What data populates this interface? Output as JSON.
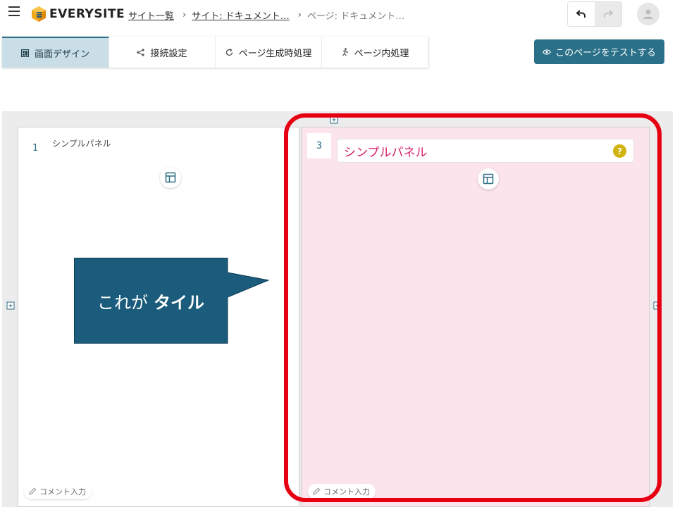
{
  "header": {
    "logo_text": "EVERYSITE",
    "breadcrumb": [
      {
        "label": "サイト一覧",
        "link": true
      },
      {
        "label": "サイト: ドキュメント…",
        "link": true
      },
      {
        "label": "ページ: ドキュメント…",
        "link": false
      }
    ]
  },
  "tabs": [
    {
      "label": "画面デザイン",
      "icon": "design-icon",
      "active": true
    },
    {
      "label": "接続設定",
      "icon": "connection-icon",
      "active": false
    },
    {
      "label": "ページ生成時処理",
      "icon": "refresh-icon",
      "active": false
    },
    {
      "label": "ページ内処理",
      "icon": "runner-icon",
      "active": false
    }
  ],
  "test_button_label": "このページをテストする",
  "tiles": {
    "left": {
      "number": "1",
      "title": "シンプルパネル",
      "comment_label": "コメント入力"
    },
    "right": {
      "number": "3",
      "title": "シンプルパネル",
      "help": "?",
      "comment_label": "コメント入力"
    }
  },
  "callout": {
    "text_prefix": "これが",
    "text_bold": "タイル"
  },
  "colors": {
    "accent": "#2b7089",
    "active_tab_bg": "#c9dee6",
    "selected_tile_bg": "#fce4ec",
    "title_text": "#d6216c",
    "callout_bg": "#1b5c7c",
    "highlight": "#e60012"
  }
}
